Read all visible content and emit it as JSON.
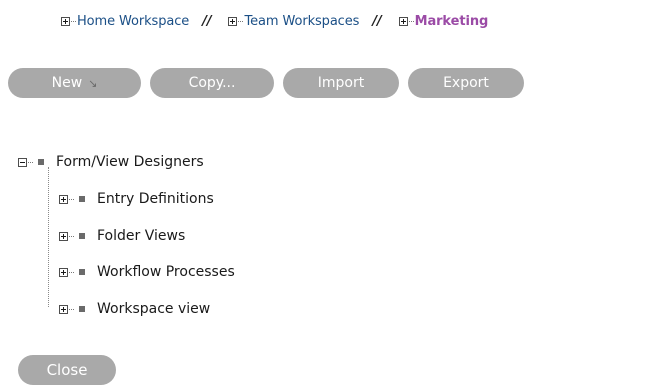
{
  "breadcrumb": {
    "items": [
      {
        "label": "Home Workspace"
      },
      {
        "label": "Team Workspaces"
      },
      {
        "label": "Marketing"
      }
    ],
    "separator": "//"
  },
  "toolbar": {
    "new_label": "New",
    "new_icon": "arrow-down-right-icon",
    "copy_label": "Copy...",
    "import_label": "Import",
    "export_label": "Export"
  },
  "tree": {
    "root": {
      "label": "Form/View Designers",
      "expanded": true
    },
    "children": [
      {
        "label": "Entry Definitions",
        "expanded": false
      },
      {
        "label": "Folder Views",
        "expanded": false
      },
      {
        "label": "Workflow Processes",
        "expanded": false
      },
      {
        "label": "Workspace view",
        "expanded": false
      }
    ]
  },
  "footer": {
    "close_label": "Close"
  },
  "colors": {
    "link": "#1b4f86",
    "current": "#9b4ba6",
    "button": "#a9a9a9"
  }
}
